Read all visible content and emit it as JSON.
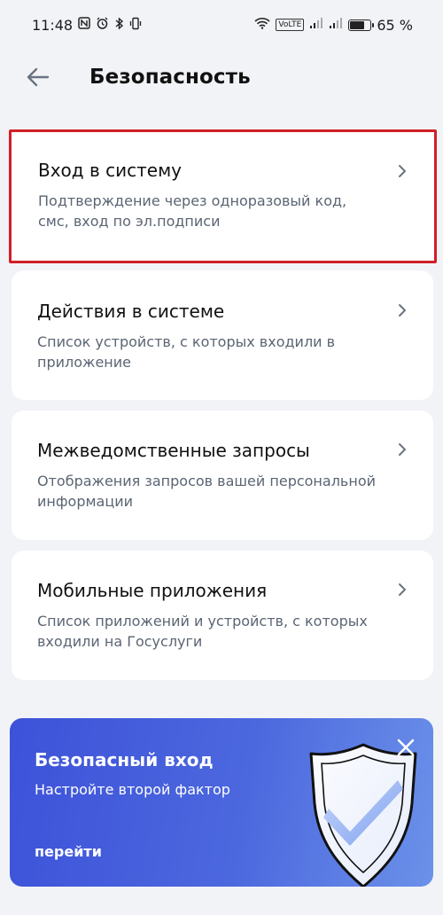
{
  "status_bar": {
    "time": "11:48",
    "battery_percent": "65 %",
    "battery_level": 0.65,
    "network_label": "VoLTE",
    "icons": [
      "nfc-icon",
      "alarm-icon",
      "bluetooth-icon",
      "vibrate-icon",
      "wifi-icon",
      "signal-icon",
      "signal-icon",
      "battery-icon"
    ]
  },
  "header": {
    "back_icon": "arrow-left-icon",
    "title": "Безопасность"
  },
  "cards": [
    {
      "title": "Вход в систему",
      "description": "Подтверждение через одноразовый код, смс, вход по эл.подписи",
      "highlighted": true
    },
    {
      "title": "Действия в системе",
      "description": "Список устройств, с которых входили в приложение",
      "highlighted": false
    },
    {
      "title": "Межведомственные запросы",
      "description": "Отображения запросов вашей персональной информации",
      "highlighted": false
    },
    {
      "title": "Мобильные приложения",
      "description": "Список приложений и устройств, с которых входили на Госуслуги",
      "highlighted": false
    }
  ],
  "promo": {
    "title": "Безопасный вход",
    "subtitle": "Настройте второй фактор",
    "link": "перейти",
    "close_icon": "close-icon",
    "illustration": "shield-check-icon"
  },
  "colors": {
    "background": "#f2f3f7",
    "highlight_border": "#d21f26",
    "promo_gradient_start": "#3d52d9",
    "promo_gradient_end": "#6b91e9",
    "description_text": "#5b6573"
  }
}
